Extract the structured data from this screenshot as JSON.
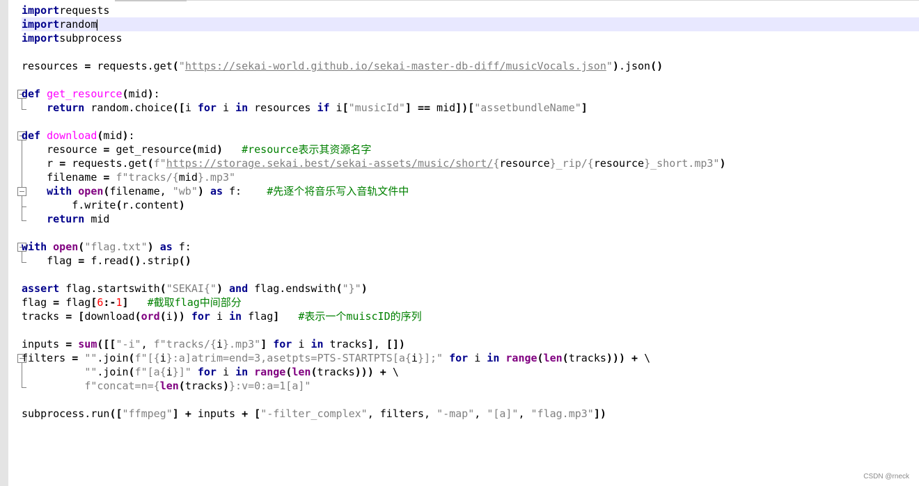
{
  "editor": {
    "lines": [
      [
        [
          "kw",
          "import"
        ],
        [
          "",
          "requests"
        ]
      ],
      [
        [
          "kw",
          "import"
        ],
        [
          "",
          "random"
        ]
      ],
      [
        [
          "kw",
          "import"
        ],
        [
          "",
          "subprocess"
        ]
      ],
      [],
      [
        [
          "",
          "resources "
        ],
        [
          "op",
          "="
        ],
        [
          "",
          " requests.get"
        ],
        [
          "op",
          "("
        ],
        [
          "str",
          "\""
        ],
        [
          "url",
          "https://sekai-world.github.io/sekai-master-db-diff/musicVocals.json"
        ],
        [
          "str",
          "\""
        ],
        [
          "op",
          ")"
        ],
        [
          "",
          ".json"
        ],
        [
          "op",
          "()"
        ]
      ],
      [],
      [
        [
          "kw",
          "def"
        ],
        [
          "",
          " "
        ],
        [
          "fn",
          "get_resource"
        ],
        [
          "op",
          "("
        ],
        [
          "",
          "mid"
        ],
        [
          "op",
          ")"
        ],
        [
          "",
          ":"
        ]
      ],
      [
        [
          "",
          "    "
        ],
        [
          "kw",
          "return"
        ],
        [
          "",
          " random.choice"
        ],
        [
          "op",
          "(["
        ],
        [
          "",
          "i "
        ],
        [
          "kw",
          "for"
        ],
        [
          "",
          " i "
        ],
        [
          "kw",
          "in"
        ],
        [
          "",
          " resources "
        ],
        [
          "kw",
          "if"
        ],
        [
          "",
          " i"
        ],
        [
          "op",
          "["
        ],
        [
          "str",
          "\"musicId\""
        ],
        [
          "op",
          "]"
        ],
        [
          "",
          " "
        ],
        [
          "op",
          "=="
        ],
        [
          "",
          " mid"
        ],
        [
          "op",
          "])["
        ],
        [
          "str",
          "\"assetbundleName\""
        ],
        [
          "op",
          "]"
        ]
      ],
      [],
      [
        [
          "kw",
          "def"
        ],
        [
          "",
          " "
        ],
        [
          "fn",
          "download"
        ],
        [
          "op",
          "("
        ],
        [
          "",
          "mid"
        ],
        [
          "op",
          ")"
        ],
        [
          "",
          ":"
        ]
      ],
      [
        [
          "",
          "    resource "
        ],
        [
          "op",
          "="
        ],
        [
          "",
          " get_resource"
        ],
        [
          "op",
          "("
        ],
        [
          "",
          "mid"
        ],
        [
          "op",
          ")"
        ],
        [
          "",
          "   "
        ],
        [
          "cm",
          "#resource表示其资源名字"
        ]
      ],
      [
        [
          "",
          "    r "
        ],
        [
          "op",
          "="
        ],
        [
          "",
          " requests.get"
        ],
        [
          "op",
          "("
        ],
        [
          "str",
          "f\""
        ],
        [
          "url",
          "https://storage.sekai.best/sekai-assets/music/short/"
        ],
        [
          "str",
          "{"
        ],
        [
          "",
          "resource"
        ],
        [
          "str",
          "}_rip/{"
        ],
        [
          "",
          "resource"
        ],
        [
          "str",
          "}_short.mp3\""
        ],
        [
          "op",
          ")"
        ]
      ],
      [
        [
          "",
          "    filename "
        ],
        [
          "op",
          "="
        ],
        [
          "",
          " "
        ],
        [
          "str",
          "f\"tracks/{"
        ],
        [
          "",
          "mid"
        ],
        [
          "str",
          "}.mp3\""
        ]
      ],
      [
        [
          "",
          "    "
        ],
        [
          "kw",
          "with"
        ],
        [
          "",
          " "
        ],
        [
          "bi",
          "open"
        ],
        [
          "op",
          "("
        ],
        [
          "",
          "filename, "
        ],
        [
          "str",
          "\"wb\""
        ],
        [
          "op",
          ")"
        ],
        [
          "",
          " "
        ],
        [
          "kw",
          "as"
        ],
        [
          "",
          " f:    "
        ],
        [
          "cm",
          "#先逐个将音乐写入音轨文件中"
        ]
      ],
      [
        [
          "",
          "        f.write"
        ],
        [
          "op",
          "("
        ],
        [
          "",
          "r.content"
        ],
        [
          "op",
          ")"
        ]
      ],
      [
        [
          "",
          "    "
        ],
        [
          "kw",
          "return"
        ],
        [
          "",
          " mid"
        ]
      ],
      [],
      [
        [
          "kw",
          "with"
        ],
        [
          "",
          " "
        ],
        [
          "bi",
          "open"
        ],
        [
          "op",
          "("
        ],
        [
          "str",
          "\"flag.txt\""
        ],
        [
          "op",
          ")"
        ],
        [
          "",
          " "
        ],
        [
          "kw",
          "as"
        ],
        [
          "",
          " f:"
        ]
      ],
      [
        [
          "",
          "    flag "
        ],
        [
          "op",
          "="
        ],
        [
          "",
          " f.read"
        ],
        [
          "op",
          "()"
        ],
        [
          "",
          ".strip"
        ],
        [
          "op",
          "()"
        ]
      ],
      [],
      [
        [
          "kw",
          "assert"
        ],
        [
          "",
          " flag.startswith"
        ],
        [
          "op",
          "("
        ],
        [
          "str",
          "\"SEKAI{\""
        ],
        [
          "op",
          ")"
        ],
        [
          "",
          " "
        ],
        [
          "kw",
          "and"
        ],
        [
          "",
          " flag.endswith"
        ],
        [
          "op",
          "("
        ],
        [
          "str",
          "\"}\""
        ],
        [
          "op",
          ")"
        ]
      ],
      [
        [
          "",
          "flag "
        ],
        [
          "op",
          "="
        ],
        [
          "",
          " flag"
        ],
        [
          "op",
          "["
        ],
        [
          "num",
          "6"
        ],
        [
          "op",
          ":-"
        ],
        [
          "num",
          "1"
        ],
        [
          "op",
          "]"
        ],
        [
          "",
          "   "
        ],
        [
          "cm",
          "#截取flag中间部分"
        ]
      ],
      [
        [
          "",
          "tracks "
        ],
        [
          "op",
          "="
        ],
        [
          "",
          " "
        ],
        [
          "op",
          "["
        ],
        [
          "",
          "download"
        ],
        [
          "op",
          "("
        ],
        [
          "bi",
          "ord"
        ],
        [
          "op",
          "("
        ],
        [
          "",
          "i"
        ],
        [
          "op",
          "))"
        ],
        [
          "",
          " "
        ],
        [
          "kw",
          "for"
        ],
        [
          "",
          " i "
        ],
        [
          "kw",
          "in"
        ],
        [
          "",
          " flag"
        ],
        [
          "op",
          "]"
        ],
        [
          "",
          "   "
        ],
        [
          "cm",
          "#表示一个muiscID的序列"
        ]
      ],
      [],
      [
        [
          "",
          "inputs "
        ],
        [
          "op",
          "="
        ],
        [
          "",
          " "
        ],
        [
          "bi",
          "sum"
        ],
        [
          "op",
          "([["
        ],
        [
          "str",
          "\"-i\""
        ],
        [
          "",
          ", "
        ],
        [
          "str",
          "f\"tracks/{"
        ],
        [
          "",
          "i"
        ],
        [
          "str",
          "}.mp3\""
        ],
        [
          "op",
          "]"
        ],
        [
          "",
          " "
        ],
        [
          "kw",
          "for"
        ],
        [
          "",
          " i "
        ],
        [
          "kw",
          "in"
        ],
        [
          "",
          " tracks"
        ],
        [
          "op",
          "]"
        ],
        [
          "",
          ", "
        ],
        [
          "op",
          "[])"
        ]
      ],
      [
        [
          "",
          "filters "
        ],
        [
          "op",
          "="
        ],
        [
          "",
          " "
        ],
        [
          "str",
          "\"\""
        ],
        [
          "",
          ".join"
        ],
        [
          "op",
          "("
        ],
        [
          "str",
          "f\"[{"
        ],
        [
          "",
          "i"
        ],
        [
          "str",
          "}:a]atrim=end=3,asetpts=PTS-STARTPTS[a{"
        ],
        [
          "",
          "i"
        ],
        [
          "str",
          "}];\""
        ],
        [
          "",
          " "
        ],
        [
          "kw",
          "for"
        ],
        [
          "",
          " i "
        ],
        [
          "kw",
          "in"
        ],
        [
          "",
          " "
        ],
        [
          "bi",
          "range"
        ],
        [
          "op",
          "("
        ],
        [
          "bi",
          "len"
        ],
        [
          "op",
          "("
        ],
        [
          "",
          "tracks"
        ],
        [
          "op",
          ")))"
        ],
        [
          "",
          " "
        ],
        [
          "op",
          "+"
        ],
        [
          "",
          " \\"
        ]
      ],
      [
        [
          "",
          "          "
        ],
        [
          "str",
          "\"\""
        ],
        [
          "",
          ".join"
        ],
        [
          "op",
          "("
        ],
        [
          "str",
          "f\"[a{"
        ],
        [
          "",
          "i"
        ],
        [
          "str",
          "}]\""
        ],
        [
          "",
          " "
        ],
        [
          "kw",
          "for"
        ],
        [
          "",
          " i "
        ],
        [
          "kw",
          "in"
        ],
        [
          "",
          " "
        ],
        [
          "bi",
          "range"
        ],
        [
          "op",
          "("
        ],
        [
          "bi",
          "len"
        ],
        [
          "op",
          "("
        ],
        [
          "",
          "tracks"
        ],
        [
          "op",
          ")))"
        ],
        [
          "",
          " "
        ],
        [
          "op",
          "+"
        ],
        [
          "",
          " \\"
        ]
      ],
      [
        [
          "",
          "          "
        ],
        [
          "str",
          "f\"concat=n={"
        ],
        [
          "bi",
          "len"
        ],
        [
          "op",
          "("
        ],
        [
          "",
          "tracks"
        ],
        [
          "op",
          ")"
        ],
        [
          "str",
          "}:v=0:a=1[a]\""
        ]
      ],
      [],
      [
        [
          "",
          "subprocess.run"
        ],
        [
          "op",
          "(["
        ],
        [
          "str",
          "\"ffmpeg\""
        ],
        [
          "op",
          "]"
        ],
        [
          "",
          " "
        ],
        [
          "op",
          "+"
        ],
        [
          "",
          " inputs "
        ],
        [
          "op",
          "+"
        ],
        [
          "",
          " "
        ],
        [
          "op",
          "["
        ],
        [
          "str",
          "\"-filter_complex\""
        ],
        [
          "",
          ", filters, "
        ],
        [
          "str",
          "\"-map\""
        ],
        [
          "",
          ", "
        ],
        [
          "str",
          "\"[a]\""
        ],
        [
          "",
          ", "
        ],
        [
          "str",
          "\"flag.mp3\""
        ],
        [
          "op",
          "])"
        ]
      ]
    ],
    "current_line_index": 1,
    "fold_points": [
      6,
      9,
      17,
      25
    ]
  },
  "watermark": "CSDN @rneck"
}
